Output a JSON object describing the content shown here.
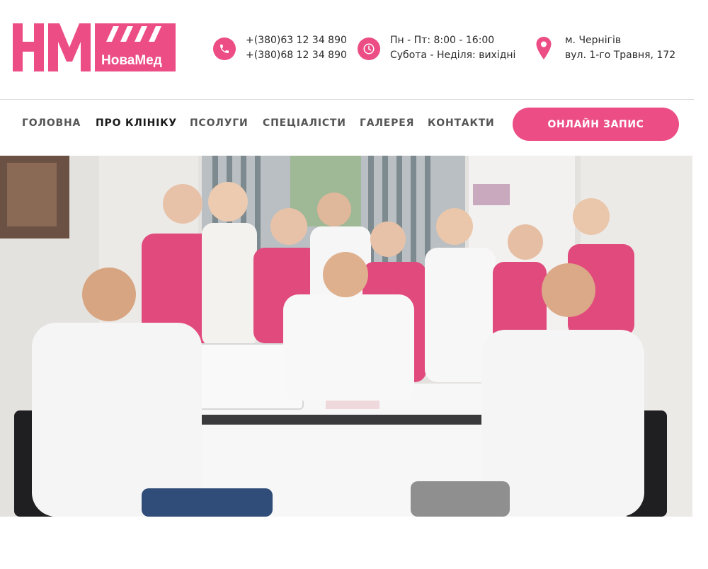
{
  "brand": {
    "mark": "НМ",
    "name": "НоваМед",
    "accent": "#ec4d84"
  },
  "contacts": {
    "phones": [
      "+(380)63 12 34 890",
      "+(380)68 12 34 890"
    ],
    "hours": [
      "Пн - Пт: 8:00 - 16:00",
      "Субота - Неділя: вихідні"
    ],
    "address": [
      "м. Чернігів",
      "вул. 1-го Травня, 172"
    ],
    "icons": {
      "phone": "phone-icon",
      "hours": "clock-icon",
      "address": "map-pin-icon"
    }
  },
  "nav": {
    "items": [
      {
        "label": "ГОЛОВНА"
      },
      {
        "label": "ПРО КЛІНІКУ"
      },
      {
        "label": "ПСОЛУГИ"
      },
      {
        "label": "СПЕЦІАЛІСТИ"
      },
      {
        "label": "ГАЛЕРЕЯ"
      },
      {
        "label": "КОНТАКТИ"
      }
    ],
    "active_index": 1,
    "cta_label": "ОНЛАЙН ЗАПИС"
  },
  "hero": {
    "colors": {
      "wall": "#e4e2df",
      "scrub_pink": "#e14a7d",
      "coat_white": "#f7f7f7"
    }
  }
}
